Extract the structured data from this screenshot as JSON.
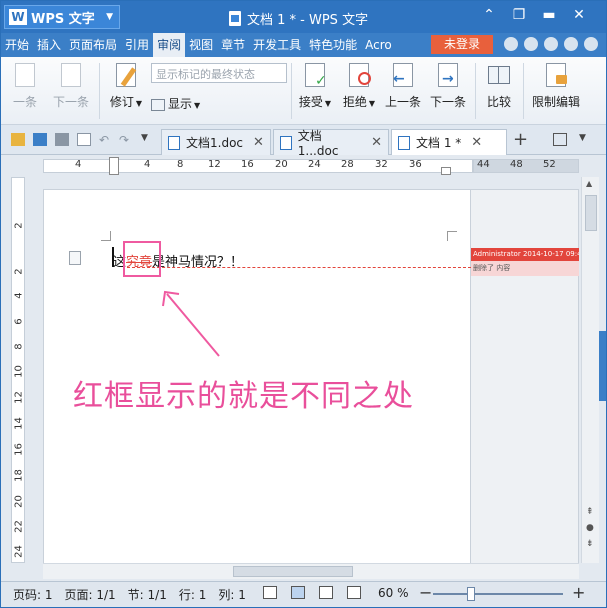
{
  "app": {
    "name": "WPS 文字",
    "logo_letter": "W",
    "window_title": "文档 1 * - WPS 文字"
  },
  "menu": {
    "items": [
      "开始",
      "插入",
      "页面布局",
      "引用",
      "审阅",
      "视图",
      "章节",
      "开发工具",
      "特色功能",
      "Acro"
    ],
    "active": "审阅",
    "login_label": "未登录"
  },
  "ribbon": {
    "prev_label": "一条",
    "next_label": "下一条",
    "revise_label": "修订",
    "display_label": "显示",
    "markup_select": "显示标记的最终状态",
    "accept_label": "接受",
    "reject_label": "拒绝",
    "prev_change_label": "上一条",
    "next_change_label": "下一条",
    "compare_label": "比较",
    "restrict_label": "限制编辑"
  },
  "tabs": [
    {
      "label": "文档1.doc",
      "active": false
    },
    {
      "label": "文档1...doc",
      "active": false
    },
    {
      "label": "文档 1 *",
      "active": true
    }
  ],
  "ruler": {
    "h_ticks": [
      "4",
      "4",
      "8",
      "12",
      "16",
      "20",
      "24",
      "28",
      "32",
      "36",
      "44",
      "48",
      "52"
    ],
    "v_ticks": [
      "2",
      "2",
      "4",
      "6",
      "8",
      "10",
      "12",
      "14",
      "16",
      "18",
      "20",
      "22",
      "24"
    ]
  },
  "document": {
    "text_prefix": "这",
    "deleted_text": "究竟",
    "text_suffix": "是神马情况？！",
    "annotation": "红框显示的就是不同之处"
  },
  "comment": {
    "header": "Administrator 2014-10-17 09:4",
    "body": "删除了 内容"
  },
  "status": {
    "page_no": "页码: 1",
    "page_count": "页面: 1/1",
    "section": "节: 1/1",
    "row": "行: 1",
    "col": "列: 1",
    "zoom": "60 %"
  },
  "zoom_level": 60,
  "colors": {
    "title_bar": "#2f74c0",
    "menu_bar": "#3b7fc7",
    "login": "#e8603c",
    "delete": "#e2453c",
    "annotation": "#e94f9b"
  }
}
